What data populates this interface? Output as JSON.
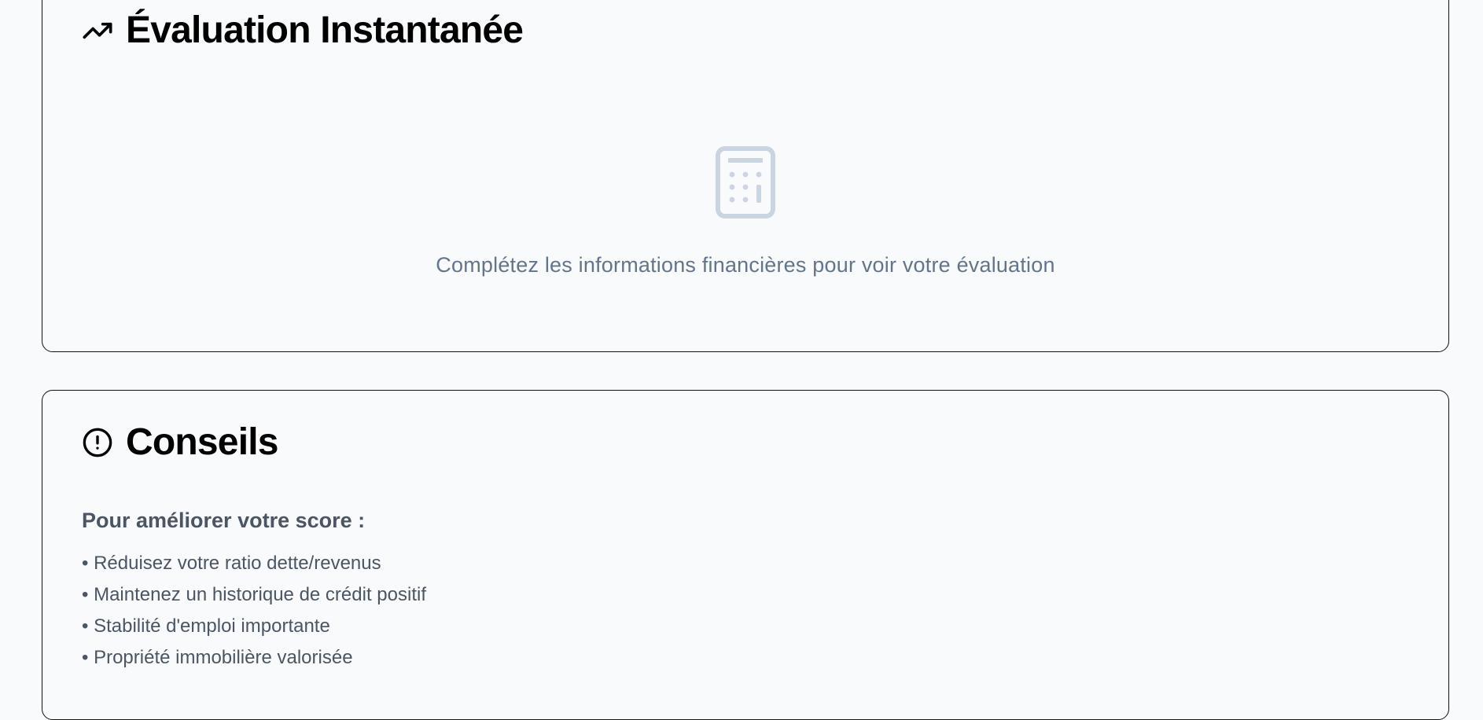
{
  "evaluation": {
    "title": "Évaluation Instantanée",
    "icon": "trending-up-icon",
    "empty_icon": "calculator-icon",
    "empty_message": "Complétez les informations financières pour voir votre évaluation"
  },
  "conseils": {
    "title": "Conseils",
    "icon": "alert-circle-icon",
    "subtitle": "Pour améliorer votre score :",
    "tips": [
      "Réduisez votre ratio dette/revenus",
      "Maintenez un historique de crédit positif",
      "Stabilité d'emploi importante",
      "Propriété immobilière valorisée"
    ]
  },
  "colors": {
    "background": "#f8fafc",
    "muted_text": "#64748b",
    "body_text": "#4b5563",
    "icon_placeholder": "#cbd5e1"
  }
}
